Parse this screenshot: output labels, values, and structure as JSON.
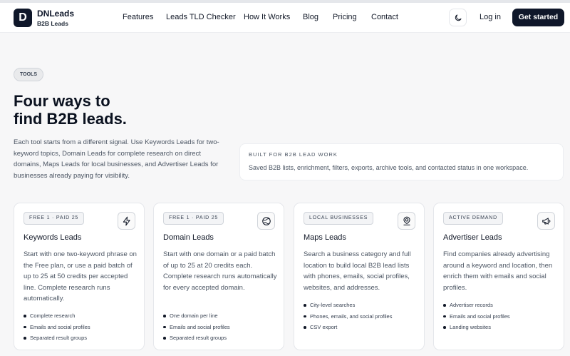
{
  "brand": {
    "name": "DNLeads",
    "subtitle": "B2B Leads",
    "logo_letter": "D"
  },
  "nav": {
    "items": [
      "Features",
      "Leads TLD Checker",
      "How It Works",
      "Blog",
      "Pricing",
      "Contact"
    ],
    "login_label": "Log in",
    "cta_label": "Get started",
    "theme_icon": "moon-icon"
  },
  "hero": {
    "pill": "TOOLS",
    "title_line1": "Four ways to",
    "title_line2": "find B2B leads.",
    "description": "Each tool starts from a different signal. Use Keywords Leads for two-keyword topics, Domain Leads for complete research on direct domains, Maps Leads for local businesses, and Advertiser Leads for businesses already paying for visibility."
  },
  "info_card": {
    "label": "BUILT FOR B2B LEAD WORK",
    "text": "Saved B2B lists, enrichment, filters, exports, archive tools, and contacted status in one workspace."
  },
  "cards": [
    {
      "badge": "FREE 1 · PAID 25",
      "icon": "lightning-icon",
      "title": "Keywords Leads",
      "description": "Start with one two-keyword phrase on the Free plan, or use a paid batch of up to 25 at 50 credits per accepted line. Complete research runs automatically.",
      "features": [
        "Complete research",
        "Emails and social profiles",
        "Separated result groups"
      ]
    },
    {
      "badge": "FREE 1 · PAID 25",
      "icon": "globe-icon",
      "title": "Domain Leads",
      "description": "Start with one domain or a paid batch of up to 25 at 20 credits each. Complete research runs automatically for every accepted domain.",
      "features": [
        "One domain per line",
        "Emails and social profiles",
        "Separated result groups"
      ]
    },
    {
      "badge": "LOCAL BUSINESSES",
      "icon": "map-pin-icon",
      "title": "Maps Leads",
      "description": "Search a business category and full location to build local B2B lead lists with phones, emails, social profiles, websites, and addresses.",
      "features": [
        "City-level searches",
        "Phones, emails, and social profiles",
        "CSV export"
      ]
    },
    {
      "badge": "ACTIVE DEMAND",
      "icon": "megaphone-icon",
      "title": "Advertiser Leads",
      "description": "Find companies already advertising around a keyword and location, then enrich them with emails and social profiles.",
      "features": [
        "Advertiser records",
        "Emails and social profiles",
        "Landing websites"
      ]
    }
  ]
}
